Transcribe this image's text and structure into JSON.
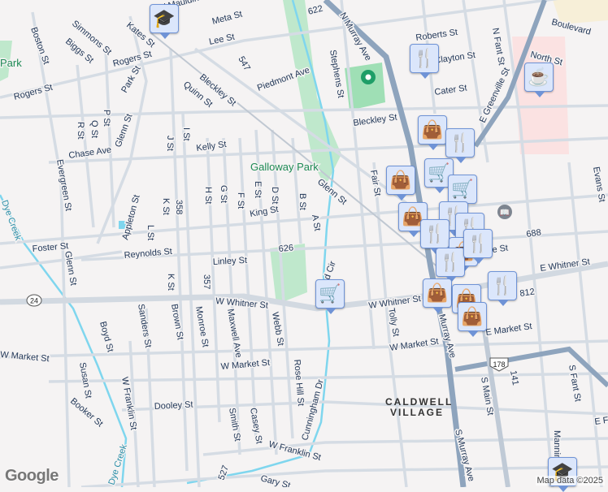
{
  "map": {
    "street_labels": [
      "W Mauldin St",
      "Meta St",
      "622",
      "Boston St",
      "Simmons St",
      "Kates St",
      "Lee St",
      "Biggs St",
      "Rogers St",
      "Rogers St",
      "Park St",
      "Bleckley St",
      "Quinn St",
      "547",
      "Piedmont Ave",
      "Stephens St",
      "Roberts St",
      "Clayton St",
      "Cater St",
      "N Fant St",
      "Boulevard",
      "North St",
      "E Greenville St",
      "Bleckley St",
      "P St",
      "Q St",
      "R St",
      "Glenn St",
      "Chase Ave",
      "J St",
      "I St",
      "Kelly St",
      "Evergreen St",
      "H St",
      "G St",
      "F St",
      "E St",
      "D St",
      "B St",
      "A St",
      "King St",
      "Appleton St",
      "L St",
      "K St",
      "358",
      "Glenn St",
      "Fair St",
      "Evans St",
      "688",
      "rle St",
      "Foster St",
      "Glenn St",
      "Reynolds St",
      "Linley St",
      "626",
      "d Cir",
      "W Whitner St",
      "W Whitner St",
      "E Whitner St",
      "812",
      "K St",
      "357",
      "Sanders St",
      "Brown St",
      "Monroe St",
      "Maxwell Ave",
      "Webb St",
      "Rose Hill St",
      "Boyd St",
      "W Market St",
      "W Market St",
      "W Market St",
      "E Market St",
      "Tolly St",
      "Susan St",
      "W Franklin St",
      "Booker St",
      "Dooley St",
      "Smith St",
      "Casey St",
      "W Franklin St",
      "Cunningham Dr",
      "N Murray Ave",
      "Murray Ave",
      "S Murray Ave",
      "S Main St",
      "141",
      "S Fant St",
      "Mannin",
      "E F",
      "527",
      "Gary St"
    ],
    "park_labels": [
      "Park",
      "Galloway Park"
    ],
    "creek_labels": [
      "Dye Creek",
      "Dye Creek"
    ],
    "neighborhood": [
      "CALDWELL",
      "VILLAGE"
    ],
    "route_shields": [
      "24",
      "178"
    ],
    "attribution": "Map data ©2025",
    "logo": "Google",
    "colors": {
      "background": "#f5f3f3",
      "road": "#d5dce4",
      "arterial": "#8ea4bd",
      "park": "#bfe8cc",
      "water": "#7fd6ee",
      "marker": "#dbe6fb",
      "icon": "#0d4468"
    }
  },
  "markers": [
    {
      "type": "school",
      "icon": "🎓"
    },
    {
      "type": "restaurant",
      "icon": "🍴"
    },
    {
      "type": "cafe",
      "icon": "☕"
    },
    {
      "type": "shopping",
      "icon": "👜"
    },
    {
      "type": "restaurant",
      "icon": "🍴"
    },
    {
      "type": "grocery",
      "icon": "🛒"
    },
    {
      "type": "shopping",
      "icon": "👜"
    },
    {
      "type": "grocery",
      "icon": "🛒"
    },
    {
      "type": "restaurant",
      "icon": "🍴"
    },
    {
      "type": "shopping",
      "icon": "👜"
    },
    {
      "type": "restaurant",
      "icon": "🍴"
    },
    {
      "type": "restaurant",
      "icon": "🍴"
    },
    {
      "type": "shopping",
      "icon": "👜"
    },
    {
      "type": "restaurant",
      "icon": "🍴"
    },
    {
      "type": "grocery",
      "icon": "🛒"
    },
    {
      "type": "shopping",
      "icon": "👜"
    },
    {
      "type": "shopping",
      "icon": "👜"
    },
    {
      "type": "restaurant",
      "icon": "🍴"
    },
    {
      "type": "shopping",
      "icon": "👜"
    },
    {
      "type": "school",
      "icon": "🎓"
    },
    {
      "type": "restaurant",
      "icon": "🍴"
    }
  ]
}
